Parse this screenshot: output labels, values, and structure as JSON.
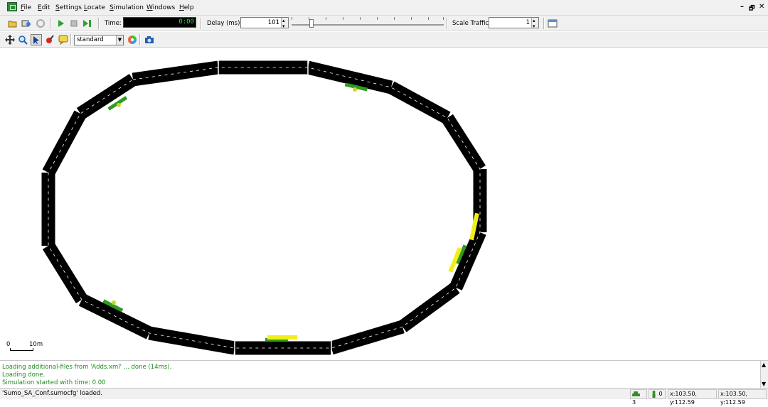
{
  "menu": {
    "items": [
      {
        "key": "F",
        "rest": "ile"
      },
      {
        "key": "E",
        "rest": "dit"
      },
      {
        "key": "S",
        "rest": "ettings"
      },
      {
        "key": "L",
        "rest": "ocate"
      },
      {
        "key": "S",
        "rest": "imulation"
      },
      {
        "key": "W",
        "rest": "indows"
      },
      {
        "key": "H",
        "rest": "elp"
      }
    ],
    "window_controls": [
      "–",
      "🗗",
      "✕"
    ]
  },
  "toolbar": {
    "time_label": "Time:",
    "time_value": "0:00",
    "delay_label": "Delay (ms):",
    "delay_value": "101",
    "delay_fraction": 0.12,
    "scale_label": "Scale Traffic:",
    "scale_value": "1"
  },
  "view_toolbar": {
    "scheme": "standard"
  },
  "scale_bar": {
    "zero": "0",
    "length": "10m"
  },
  "messages": [
    "Loading additional-files from 'Adds.xml' ... done (14ms).",
    "Loading done.",
    "Simulation started with time: 0.00"
  ],
  "status": {
    "message": "'Sumo_SA_Conf.sumocfg' loaded.",
    "vehicles": "3",
    "persons": "0",
    "coord1": "x:103.50, y:112.59",
    "coord2": "x:103.50, y:112.59"
  },
  "colors": {
    "road": "#000000",
    "marking": "#ffffff",
    "stop": "#2e9c1e",
    "vehicle": "#f2ee1a",
    "message": "#1f8a1f"
  }
}
